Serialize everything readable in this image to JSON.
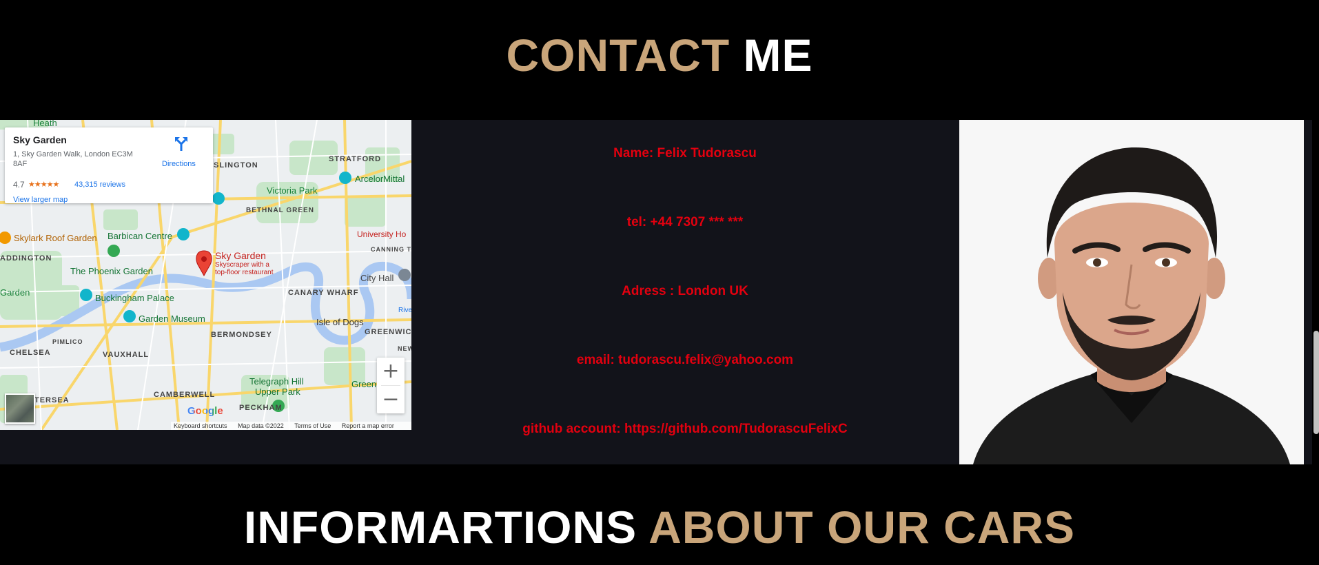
{
  "contact_heading": {
    "accent": "CONTACT",
    "plain": "ME"
  },
  "cars_heading": {
    "plain": "INFORMARTIONS",
    "accent": "ABOUT OUR CARS"
  },
  "map": {
    "place_name": "Sky Garden",
    "address": "1, Sky Garden Walk, London EC3M 8AF",
    "rating": "4.7",
    "stars": "★★★★★",
    "reviews": "43,315 reviews",
    "view_larger": "View larger map",
    "directions": "Directions",
    "zoom_in": "+",
    "zoom_out": "−",
    "google": "Google",
    "footer": [
      "Keyboard shortcuts",
      "Map data ©2022",
      "Terms of Use",
      "Report a map error"
    ],
    "labels": {
      "heath": "Heath",
      "islington": "ISLINGTON",
      "stratford": "STRATFORD",
      "arcelor": "ArcelorMittal",
      "victoria_park": "Victoria Park",
      "bethnal_green": "BETHNAL GREEN",
      "barbican": "Barbican Centre",
      "skylark": "Skylark Roof Garden",
      "paddington": "ADDINGTON",
      "phoenix": "The Phoenix Garden",
      "sky_garden": "Sky Garden",
      "sky_garden_sub1": "Skyscraper with a",
      "sky_garden_sub2": "top-floor restaurant",
      "university": "University Ho",
      "canning": "CANNING TO",
      "city_hall": "City Hall",
      "canary": "CANARY WHARF",
      "garden_left": "Garden",
      "buckingham": "Buckingham Palace",
      "garden_museum": "Garden Museum",
      "isle_dogs": "Isle of Dogs",
      "bermondsey": "BERMONDSEY",
      "greenwich": "GREENWIC",
      "chelsea": "CHELSEA",
      "vauxhall": "VAUXHALL",
      "pimlico": "PIMLICO",
      "telegraph": "Telegraph Hill",
      "upper_park": "Upper Park",
      "camberwell": "CAMBERWELL",
      "peckham": "PECKHAM",
      "battersea": "TERSEA",
      "green_right": "Green",
      "new_right": "NEW",
      "river": "River"
    }
  },
  "info": {
    "name": "Name: Felix Tudorascu",
    "tel": "tel: +44 7307 *** ***",
    "address": "Adress : London UK",
    "email": "email: tudorascu.felix@yahoo.com",
    "github": "github account: https://github.com/TudorascuFelixC"
  },
  "colors": {
    "accent": "#c9a57a",
    "info_text": "#e3000f",
    "band": "#12131a"
  }
}
